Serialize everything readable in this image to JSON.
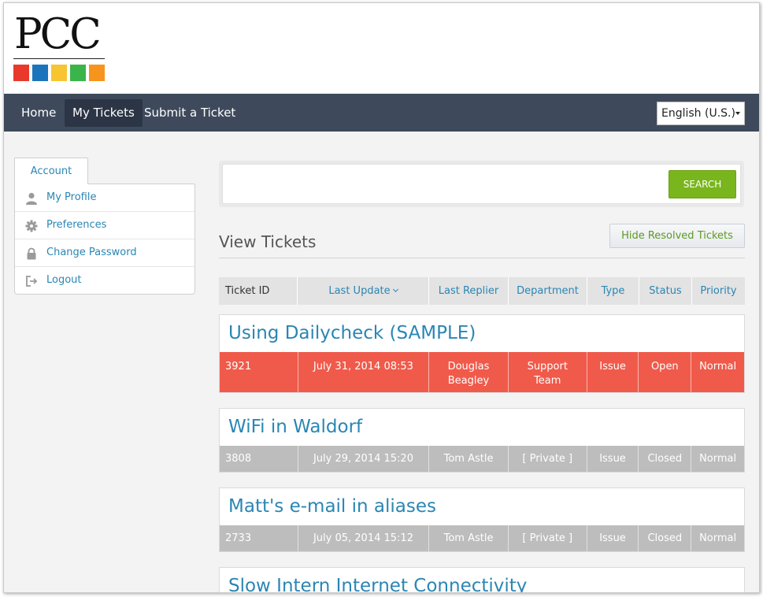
{
  "logo": {
    "text": "PCC",
    "squares": [
      "#e8392b",
      "#1b75bc",
      "#f7c531",
      "#3bb54a",
      "#f7941d"
    ]
  },
  "nav": {
    "items": [
      {
        "label": "Home",
        "active": false
      },
      {
        "label": "My Tickets",
        "active": true
      },
      {
        "label": "Submit a Ticket",
        "active": false
      }
    ],
    "language": "English (U.S.)"
  },
  "sidebar": {
    "tab": "Account",
    "items": [
      {
        "label": "My Profile",
        "icon": "user-icon"
      },
      {
        "label": "Preferences",
        "icon": "gear-icon"
      },
      {
        "label": "Change Password",
        "icon": "lock-icon"
      },
      {
        "label": "Logout",
        "icon": "logout-icon"
      }
    ]
  },
  "search": {
    "placeholder": "",
    "button": "SEARCH"
  },
  "tickets_view": {
    "title": "View Tickets",
    "hide_button": "Hide Resolved Tickets",
    "columns": [
      "Ticket ID",
      "Last Update",
      "Last Replier",
      "Department",
      "Type",
      "Status",
      "Priority"
    ],
    "sorted_column": "Last Update"
  },
  "tickets": [
    {
      "title": "Using Dailycheck (SAMPLE)",
      "id": "3921",
      "last_update": "July 31, 2014 08:53",
      "last_replier": "Douglas Beagley",
      "department": "Support Team",
      "type": "Issue",
      "status": "Open",
      "priority": "Normal"
    },
    {
      "title": "WiFi in Waldorf",
      "id": "3808",
      "last_update": "July 29, 2014 15:20",
      "last_replier": "Tom Astle",
      "department": "[ Private ]",
      "type": "Issue",
      "status": "Closed",
      "priority": "Normal"
    },
    {
      "title": "Matt's e-mail in aliases",
      "id": "2733",
      "last_update": "July 05, 2014 15:12",
      "last_replier": "Tom Astle",
      "department": "[ Private ]",
      "type": "Issue",
      "status": "Closed",
      "priority": "Normal"
    },
    {
      "title": "Slow Intern Internet Connectivity"
    }
  ],
  "colors": {
    "navbar": "#3e4a5c",
    "accent": "#2a86b4",
    "open_row": "#f05a4a",
    "closed_row": "#bdbdbd",
    "search_button": "#79b51c"
  }
}
